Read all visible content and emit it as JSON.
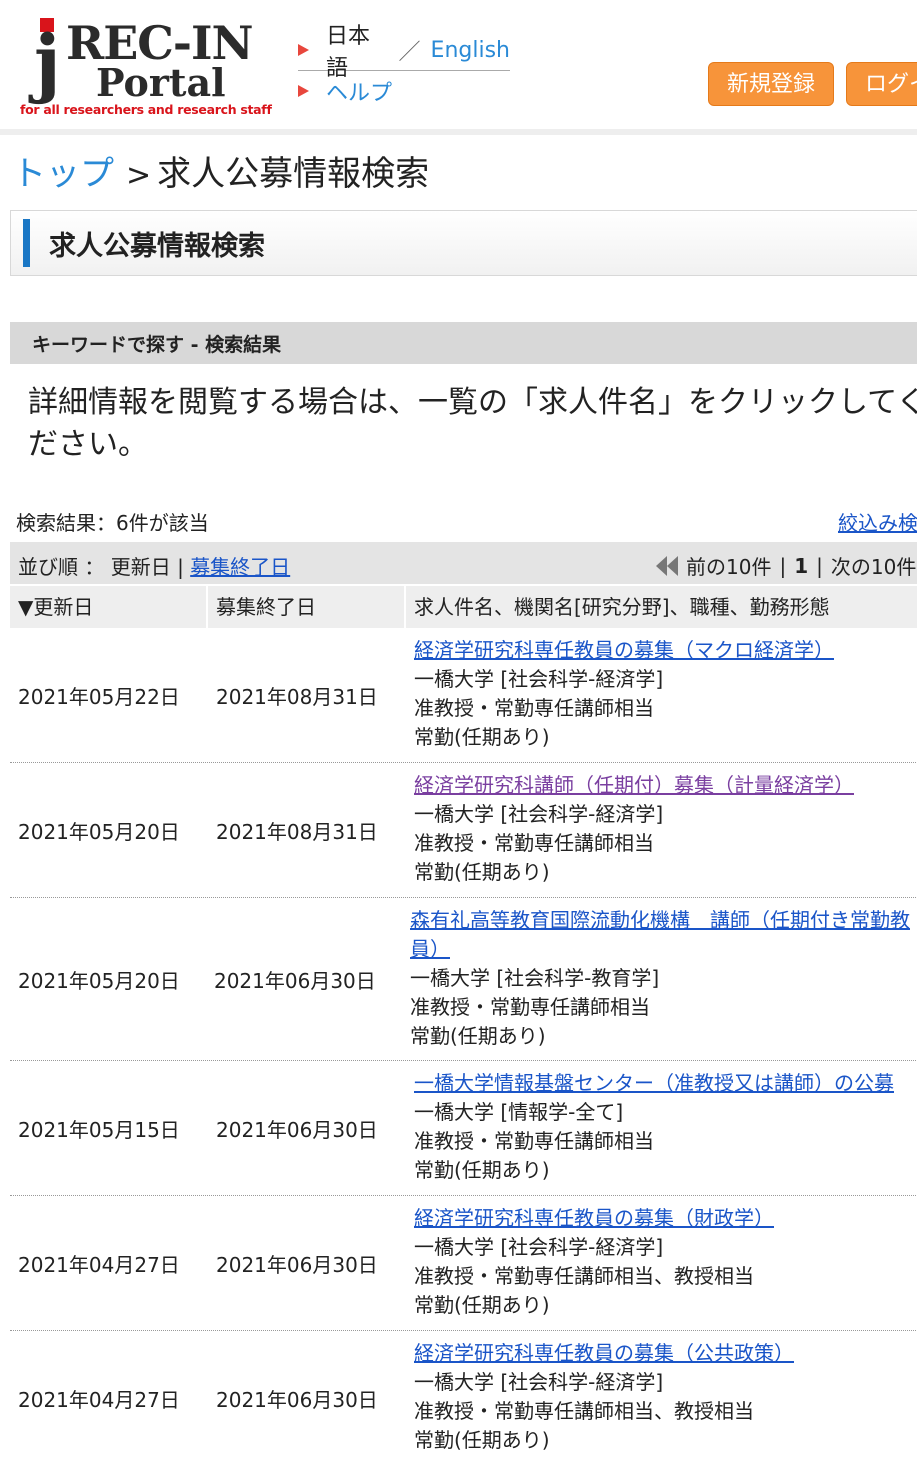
{
  "header": {
    "logo": {
      "mark": "jREC-IN",
      "line1": "REC-IN",
      "line2": "Portal",
      "tagline": "for all researchers and research staff"
    },
    "nav": {
      "lang_current": "日本語",
      "lang_sep": "／",
      "lang_other": "English",
      "help": "ヘルプ"
    },
    "buttons": {
      "register": "新規登録",
      "login": "ログイン"
    }
  },
  "breadcrumb": {
    "top": "トップ",
    "sep": ">",
    "current": "求人公募情報検索"
  },
  "page_title": "求人公募情報検索",
  "section_title": "キーワードで探す - 検索結果",
  "instruction": "詳細情報を閲覧する場合は、一覧の「求人件名」をクリックしてください。",
  "results": {
    "count_label": "検索結果：",
    "count_value": "6件が該当",
    "filter_link": "絞込み検索"
  },
  "sort": {
    "label": "並び順 ： ",
    "by_updated": "更新日",
    "sep": "|",
    "by_deadline": "募集終了日"
  },
  "pagination": {
    "prev": "前の10件",
    "sep": "|",
    "current": "1",
    "next": "次の10件"
  },
  "table": {
    "headers": {
      "updated": "▼更新日",
      "deadline": "募集終了日",
      "title": "求人件名、機関名[研究分野]、職種、勤務形態"
    },
    "rows": [
      {
        "updated": "2021年05月22日",
        "deadline": "2021年08月31日",
        "title": "経済学研究科専任教員の募集（マクロ経済学）",
        "org": "一橋大学 [社会科学-経済学]",
        "position": "准教授・常勤専任講師相当",
        "employment": "常勤(任期あり)"
      },
      {
        "updated": "2021年05月20日",
        "deadline": "2021年08月31日",
        "title": "経済学研究科講師（任期付）募集（計量経済学）",
        "org": "一橋大学 [社会科学-経済学]",
        "position": "准教授・常勤専任講師相当",
        "employment": "常勤(任期あり)"
      },
      {
        "updated": "2021年05月20日",
        "deadline": "2021年06月30日",
        "title": "森有礼高等教育国際流動化機構　講師（任期付き常勤教員）",
        "org": "一橋大学 [社会科学-教育学]",
        "position": "准教授・常勤専任講師相当",
        "employment": "常勤(任期あり)"
      },
      {
        "updated": "2021年05月15日",
        "deadline": "2021年06月30日",
        "title": "一橋大学情報基盤センター（准教授又は講師）の公募",
        "org": "一橋大学 [情報学-全て]",
        "position": "准教授・常勤専任講師相当",
        "employment": "常勤(任期あり)"
      },
      {
        "updated": "2021年04月27日",
        "deadline": "2021年06月30日",
        "title": "経済学研究科専任教員の募集（財政学）",
        "org": "一橋大学 [社会科学-経済学]",
        "position": "准教授・常勤専任講師相当、教授相当",
        "employment": "常勤(任期あり)"
      },
      {
        "updated": "2021年04月27日",
        "deadline": "2021年06月30日",
        "title": "経済学研究科専任教員の募集（公共政策）",
        "org": "一橋大学 [社会科学-経済学]",
        "position": "准教授・常勤専任講師相当、教授相当",
        "employment": "常勤(任期あり)"
      }
    ]
  },
  "colors": {
    "accent_orange": "#f7943a",
    "link_blue": "#1a55c8",
    "visited_purple": "#7a3fa0",
    "logo_red": "#d9141b"
  }
}
